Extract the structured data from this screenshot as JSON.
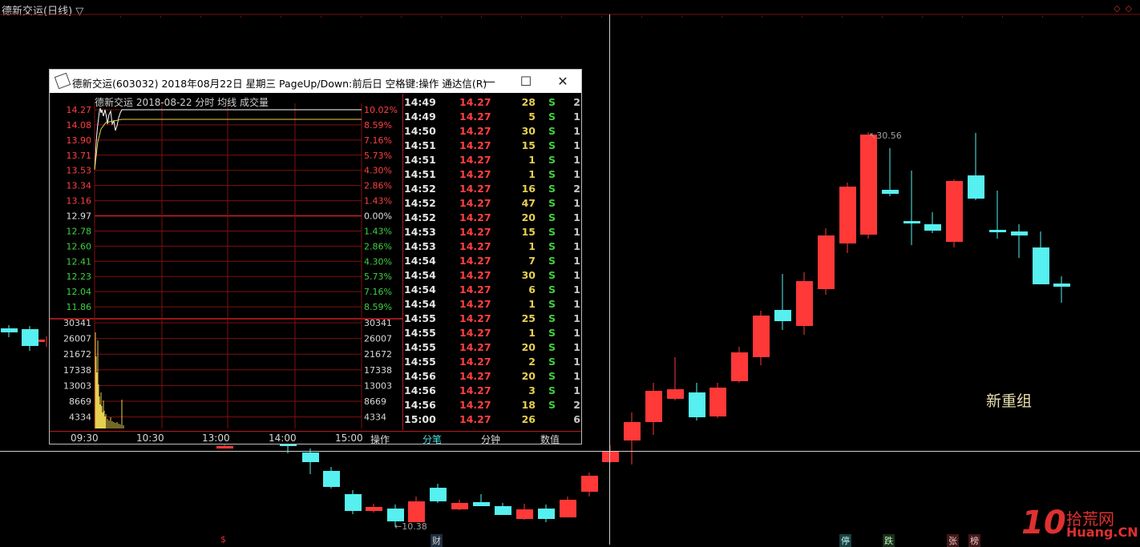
{
  "main": {
    "title": "德新交运(日线) ▽",
    "annotation": "新重组",
    "high_label": "30.56",
    "low_label": "10.38",
    "badges": [
      "$",
      "财",
      "停",
      "跌",
      "张",
      "榜"
    ],
    "colors": {
      "up": "#ff3838",
      "down": "#56f0f0",
      "up_small": "#ff3030"
    }
  },
  "candles": [
    {
      "o": 10.83,
      "h": 10.86,
      "l": 10.79,
      "c": 10.83,
      "dir": "down"
    },
    {
      "o": 10.82,
      "h": 10.82,
      "l": 10.73,
      "c": 10.74,
      "dir": "down"
    },
    {
      "o": 10.76,
      "h": 10.76,
      "l": 10.76,
      "c": 10.76,
      "dir": "up"
    }
  ],
  "candles_right": [
    {
      "o": 10.9,
      "h": 10.95,
      "l": 10.6,
      "c": 10.63,
      "dir": "down"
    },
    {
      "o": 10.63,
      "h": 10.63,
      "l": 10.48,
      "c": 10.5,
      "dir": "down"
    },
    {
      "o": 10.48,
      "h": 10.48,
      "l": 10.38,
      "c": 10.4,
      "dir": "down"
    },
    {
      "o": 10.36,
      "h": 10.38,
      "l": 10.34,
      "c": 10.37,
      "dir": "up"
    },
    {
      "o": 10.35,
      "h": 10.35,
      "l": 10.27,
      "c": 10.29,
      "dir": "down"
    },
    {
      "o": 10.28,
      "h": 10.36,
      "l": 10.28,
      "c": 10.35,
      "dir": "up"
    },
    {
      "o": 10.39,
      "h": 10.42,
      "l": 10.34,
      "c": 10.36,
      "dir": "down"
    },
    {
      "o": 10.35,
      "h": 10.37,
      "l": 10.33,
      "c": 10.35,
      "dir": "up"
    },
    {
      "o": 10.37,
      "h": 10.39,
      "l": 10.34,
      "c": 10.36,
      "dir": "down"
    },
    {
      "o": 10.34,
      "h": 10.34,
      "l": 10.32,
      "c": 10.33,
      "dir": "down"
    },
    {
      "o": 10.31,
      "h": 10.36,
      "l": 10.31,
      "c": 10.34,
      "dir": "up"
    },
    {
      "o": 10.34,
      "h": 10.34,
      "l": 10.3,
      "c": 10.31,
      "dir": "down"
    },
    {
      "o": 10.31,
      "h": 10.37,
      "l": 10.31,
      "c": 10.37,
      "dir": "up"
    },
    {
      "o": 10.44,
      "h": 10.48,
      "l": 10.44,
      "c": 10.48,
      "dir": "up"
    }
  ],
  "popup": {
    "title": "德新交运(603032) 2018年08月22日 星期三 PageUp/Down:前后日 空格键:操作 通达信(R)",
    "chart_header": "德新交运    2018-08-22 分时 均线 成交量",
    "price_labels": [
      "14.27",
      "14.08",
      "13.90",
      "13.71",
      "13.53",
      "13.34",
      "13.16",
      "12.97",
      "12.78",
      "12.60",
      "12.41",
      "12.23",
      "12.04",
      "11.86"
    ],
    "pct_labels": [
      "10.02%",
      "8.59%",
      "7.16%",
      "5.73%",
      "4.30%",
      "2.86%",
      "1.43%",
      "0.00%",
      "1.43%",
      "2.86%",
      "4.30%",
      "5.73%",
      "7.16%",
      "8.59%"
    ],
    "vol_labels": [
      "30341",
      "26007",
      "21672",
      "17338",
      "13003",
      "8669",
      "4334"
    ],
    "time_labels": [
      "09:30",
      "10:30",
      "13:00",
      "14:00",
      "15:00"
    ],
    "bottom_tabs": [
      "操作",
      "分笔",
      "分钟",
      "数值"
    ],
    "ticks": [
      {
        "time": "14:49",
        "price": "14.27",
        "vol": "28",
        "dir": "S",
        "n": "2"
      },
      {
        "time": "14:49",
        "price": "14.27",
        "vol": "5",
        "dir": "S",
        "n": "1"
      },
      {
        "time": "14:50",
        "price": "14.27",
        "vol": "30",
        "dir": "S",
        "n": "1"
      },
      {
        "time": "14:51",
        "price": "14.27",
        "vol": "15",
        "dir": "S",
        "n": "1"
      },
      {
        "time": "14:51",
        "price": "14.27",
        "vol": "1",
        "dir": "S",
        "n": "1"
      },
      {
        "time": "14:51",
        "price": "14.27",
        "vol": "1",
        "dir": "S",
        "n": "1"
      },
      {
        "time": "14:52",
        "price": "14.27",
        "vol": "16",
        "dir": "S",
        "n": "2"
      },
      {
        "time": "14:52",
        "price": "14.27",
        "vol": "47",
        "dir": "S",
        "n": "1"
      },
      {
        "time": "14:52",
        "price": "14.27",
        "vol": "20",
        "dir": "S",
        "n": "1"
      },
      {
        "time": "14:53",
        "price": "14.27",
        "vol": "15",
        "dir": "S",
        "n": "1"
      },
      {
        "time": "14:53",
        "price": "14.27",
        "vol": "1",
        "dir": "S",
        "n": "1"
      },
      {
        "time": "14:54",
        "price": "14.27",
        "vol": "7",
        "dir": "S",
        "n": "1"
      },
      {
        "time": "14:54",
        "price": "14.27",
        "vol": "30",
        "dir": "S",
        "n": "1"
      },
      {
        "time": "14:54",
        "price": "14.27",
        "vol": "6",
        "dir": "S",
        "n": "1"
      },
      {
        "time": "14:54",
        "price": "14.27",
        "vol": "1",
        "dir": "S",
        "n": "1"
      },
      {
        "time": "14:55",
        "price": "14.27",
        "vol": "25",
        "dir": "S",
        "n": "1"
      },
      {
        "time": "14:55",
        "price": "14.27",
        "vol": "1",
        "dir": "S",
        "n": "1"
      },
      {
        "time": "14:55",
        "price": "14.27",
        "vol": "20",
        "dir": "S",
        "n": "1"
      },
      {
        "time": "14:55",
        "price": "14.27",
        "vol": "2",
        "dir": "S",
        "n": "1"
      },
      {
        "time": "14:56",
        "price": "14.27",
        "vol": "20",
        "dir": "S",
        "n": "1"
      },
      {
        "time": "14:56",
        "price": "14.27",
        "vol": "3",
        "dir": "S",
        "n": "1"
      },
      {
        "time": "14:56",
        "price": "14.27",
        "vol": "18",
        "dir": "S",
        "n": "2"
      },
      {
        "time": "15:00",
        "price": "14.27",
        "vol": "26",
        "dir": "",
        "n": "6"
      }
    ]
  },
  "watermark": {
    "number": "10",
    "line1": "拾荒网",
    "line2": "Huang.CN"
  }
}
